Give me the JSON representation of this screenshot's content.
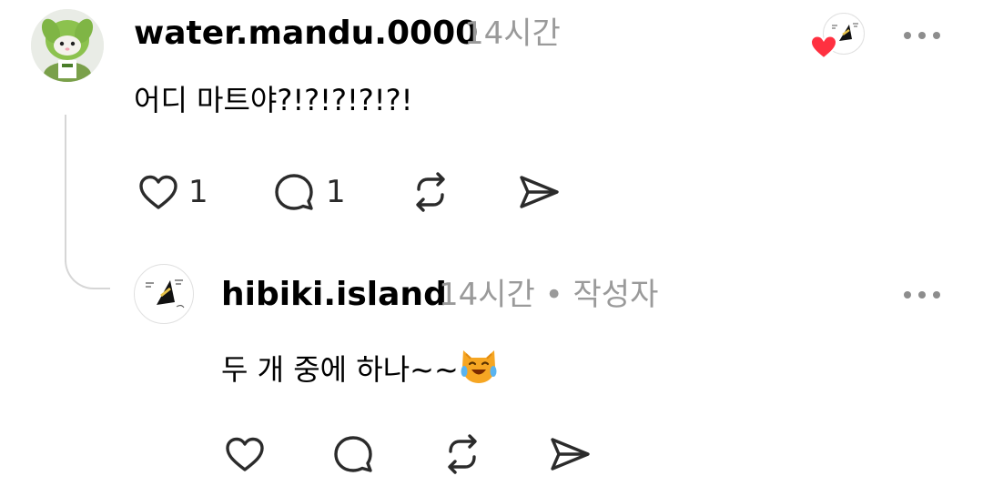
{
  "comment": {
    "username": "water.mandu.0000",
    "time": "14시간",
    "text": "어디 마트야?!?!?!?!?!",
    "liked_by_author": true,
    "actions": {
      "like_count": "1",
      "reply_count": "1"
    }
  },
  "reply": {
    "username": "hibiki.island",
    "time": "14시간",
    "separator": "•",
    "author_label": "작성자",
    "text": "두 개 중에 하나~~",
    "emoji": "cat-face-with-tears-of-joy"
  },
  "icons": {
    "like": "heart-icon",
    "comment": "comment-bubble-icon",
    "repost": "repost-icon",
    "share": "send-icon",
    "more": "more-dots-icon"
  },
  "colors": {
    "meta_gray": "#9a9a9a",
    "heart_red": "#ff3040",
    "avatar_green": "#7fb545",
    "icon_dark": "#2b2b2b"
  }
}
